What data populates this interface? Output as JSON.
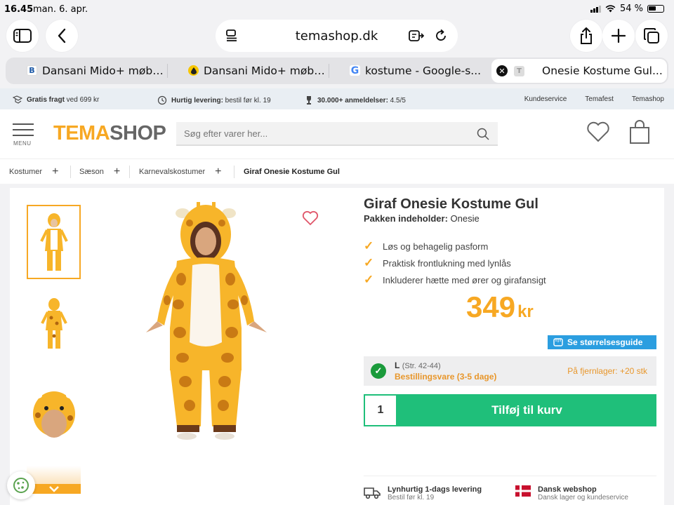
{
  "status": {
    "time": "16.45",
    "date": "man. 6. apr.",
    "battery": "54 %"
  },
  "browser": {
    "domain": "temashop.dk",
    "tabs": [
      {
        "favicon": "B",
        "label": "Dansani Mido+ møbe..."
      },
      {
        "favicon": "drop",
        "label": "Dansani Mido+ møbe..."
      },
      {
        "favicon": "G",
        "label": "kostume - Google-s..."
      },
      {
        "favicon": "T",
        "label": "Onesie Kostume Gul...",
        "active": true
      }
    ]
  },
  "infobar": {
    "shipping_bold": "Gratis fragt",
    "shipping_rest": " ved 699 kr",
    "delivery_bold": "Hurtig levering:",
    "delivery_rest": " bestil før kl. 19",
    "reviews_bold": "30.000+ anmeldelser:",
    "reviews_rest": " 4.5/5",
    "links": [
      "Kundeservice",
      "Temafest",
      "Temashop"
    ]
  },
  "header": {
    "menu_label": "MENU",
    "logo_a": "TEMA",
    "logo_b": "SHOP",
    "search_placeholder": "Søg efter varer her..."
  },
  "breadcrumbs": [
    "Kostumer",
    "Sæson",
    "Karnevalskostumer",
    "Giraf Onesie Kostume Gul"
  ],
  "product": {
    "title": "Giraf Onesie Kostume Gul",
    "pack_label": "Pakken indeholder:",
    "pack_value": " Onesie",
    "features": [
      "Løs og behagelig pasform",
      "Praktisk frontlukning med lynlås",
      "Inkluderer hætte med ører og girafansigt"
    ],
    "price": "349",
    "currency": "kr",
    "size_guide": "Se størrelsesguide",
    "size": "L",
    "size_range": "(Str. 42-44)",
    "availability": "Bestillingsvare (3-5 dage)",
    "remote_stock": "På fjernlager: +20 stk",
    "quantity": "1",
    "add_to_cart": "Tilføj til kurv"
  },
  "usps": [
    {
      "title": "Lynhurtig 1-dags levering",
      "sub": "Bestil før kl. 19"
    },
    {
      "title": "Dansk webshop",
      "sub": "Dansk lager og kundeservice"
    }
  ],
  "colors": {
    "brand": "#f7a823",
    "cta": "#1fbf7a",
    "info_blue": "#2b9ee0",
    "ok_green": "#1a9a3b"
  }
}
